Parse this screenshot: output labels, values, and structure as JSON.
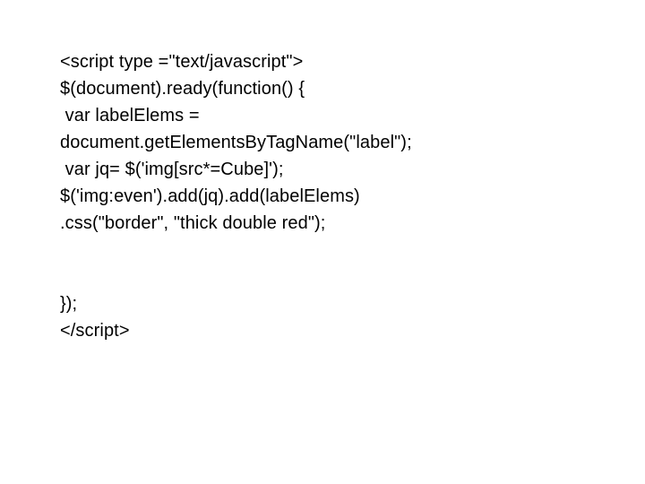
{
  "code": {
    "line1": "<script type =\"text/javascript\">",
    "line2": "$(document).ready(function() {",
    "line3a": " var labelElems =",
    "line3b": "document.getElementsByTagName(\"label\");",
    "line4": " var jq= $('img[src*=Cube]');",
    "line5": "$('img:even').add(jq).add(labelElems)",
    "line6": ".css(\"border\", \"thick double red\");",
    "blank1": "",
    "blank2": "",
    "line7": "});",
    "line8": "</script>"
  }
}
